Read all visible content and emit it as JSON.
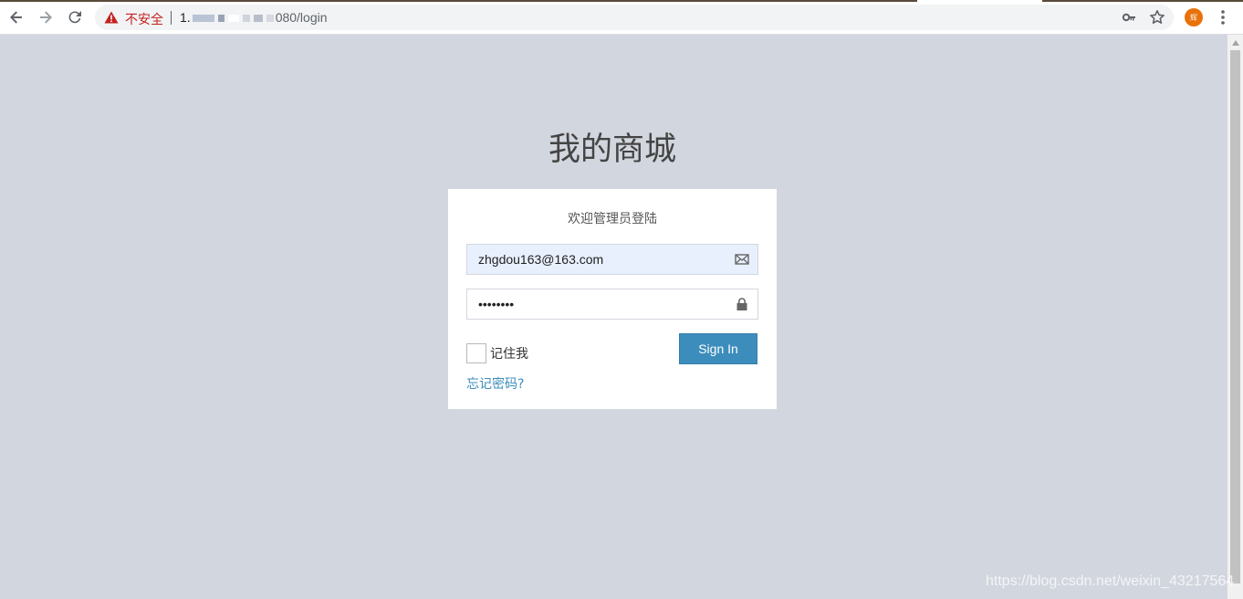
{
  "browser": {
    "security_label": "不安全",
    "url_host": "1.",
    "url_rest": "080/login",
    "avatar_text": "辉",
    "icons": [
      "back-icon",
      "forward-icon",
      "reload-icon",
      "warning-icon",
      "key-icon",
      "star-icon",
      "menu-icon"
    ]
  },
  "page": {
    "title": "我的商城",
    "box_message": "欢迎管理员登陆",
    "email": {
      "value": "zhgdou163@163.com"
    },
    "password": {
      "value": "••••••••"
    },
    "remember_label": "记住我",
    "signin_label": "Sign In",
    "forgot_label": "忘记密码?",
    "colors": {
      "background": "#d2d6de",
      "primary": "#3c8dbc",
      "autofill": "#e8f0fe"
    }
  },
  "watermark": "https://blog.csdn.net/weixin_43217564"
}
